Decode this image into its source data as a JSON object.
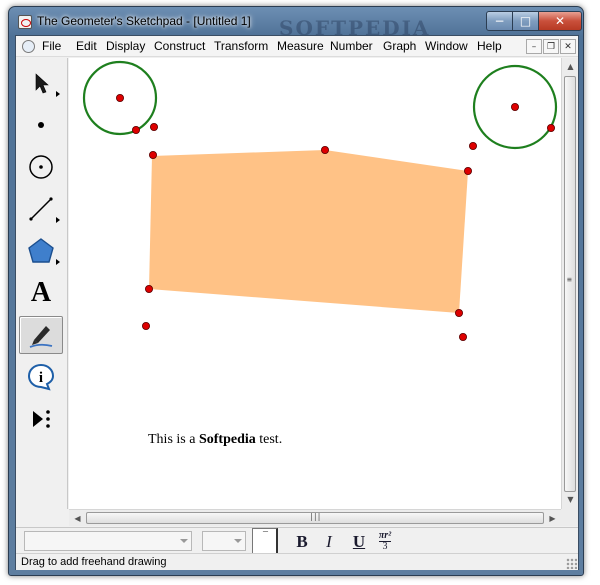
{
  "window": {
    "title": "The Geometer's Sketchpad - [Untitled 1]",
    "controls": {
      "minimize": "−",
      "maximize": "□",
      "close": "✕"
    }
  },
  "menubar": {
    "items": [
      "File",
      "Edit",
      "Display",
      "Construct",
      "Transform",
      "Measure",
      "Number",
      "Graph",
      "Window",
      "Help"
    ],
    "mdi_controls": {
      "minimize": "–",
      "restore": "❐",
      "close": "✕"
    }
  },
  "toolbox": {
    "tools": [
      {
        "name": "selection-arrow-tool",
        "icon": "arrow-icon",
        "selected": false
      },
      {
        "name": "point-tool",
        "icon": "point-icon",
        "selected": false
      },
      {
        "name": "compass-tool",
        "icon": "circle-icon",
        "selected": false
      },
      {
        "name": "straightedge-tool",
        "icon": "segment-icon",
        "selected": false
      },
      {
        "name": "polygon-tool",
        "icon": "pentagon-icon",
        "selected": false
      },
      {
        "name": "text-tool",
        "icon": "letter-a-icon",
        "label": "A",
        "selected": false
      },
      {
        "name": "marker-tool",
        "icon": "pen-icon",
        "selected": true
      },
      {
        "name": "information-tool",
        "icon": "info-icon",
        "label": "i",
        "selected": false
      },
      {
        "name": "custom-tools",
        "icon": "play-more-icon",
        "selected": false
      }
    ]
  },
  "sketch": {
    "watermark": "SOFTPEDIA",
    "polygon_fill": "#FFC286",
    "point_color": "#DD0000",
    "circle_color": "#1E7F1E",
    "text": {
      "prefix": "This is a ",
      "bold": "Softpedia",
      "suffix": " test."
    }
  },
  "text_palette": {
    "font_name": "",
    "font_size": "",
    "bold": "B",
    "italic": "I",
    "underline": "U",
    "math_format_top": "πr²",
    "math_format_bottom": "3"
  },
  "status": {
    "message": "Drag to add freehand drawing"
  },
  "colors": {
    "selected_tool_bg": "#DCDCDC",
    "title_bar": "#4E7196"
  }
}
